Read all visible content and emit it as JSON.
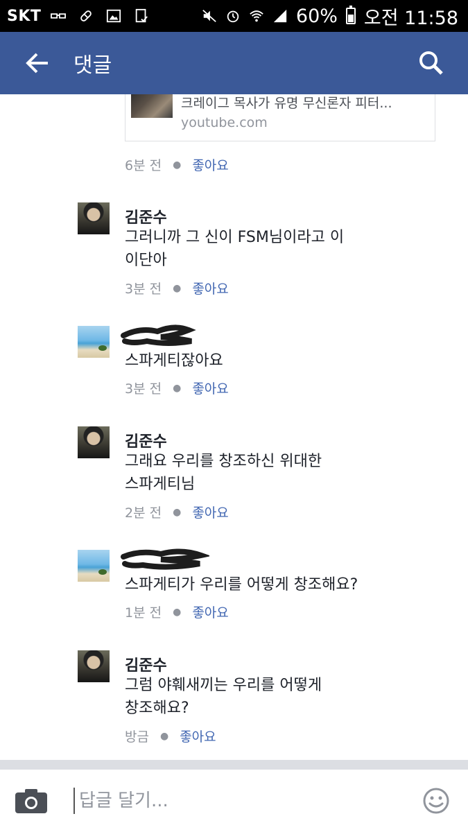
{
  "status_bar": {
    "carrier": "SKT",
    "battery": "60%",
    "time": "오전 11:58"
  },
  "header": {
    "title": "댓글",
    "back_icon": "arrow-left-icon",
    "search_icon": "search-icon",
    "color": "#3b5998"
  },
  "link_card": {
    "title": "크레이그 목사가 유명 무신론자 피터...",
    "domain": "youtube.com",
    "time": "6분 전",
    "like_label": "좋아요"
  },
  "comments": [
    {
      "name": "김준수",
      "text": "그러니까 그 신이 FSM님이라고 이\n이단아",
      "time": "3분 전",
      "like_label": "좋아요",
      "avatar": "kim"
    },
    {
      "name": "",
      "text": "스파게티잖아요",
      "time": "3분 전",
      "like_label": "좋아요",
      "avatar": "beach"
    },
    {
      "name": "김준수",
      "text": "그래요 우리를 창조하신 위대한\n스파게티님",
      "time": "2분 전",
      "like_label": "좋아요",
      "avatar": "kim"
    },
    {
      "name": "",
      "text": "스파게티가 우리를 어떻게 창조해요?",
      "time": "1분 전",
      "like_label": "좋아요",
      "avatar": "beach"
    },
    {
      "name": "김준수",
      "text": "그럼 야훼새끼는 우리를 어떻게\n창조해요?",
      "time": "방금",
      "like_label": "좋아요",
      "avatar": "kim"
    }
  ],
  "reply_bar": {
    "placeholder": "답글 달기...",
    "camera_icon": "camera-icon",
    "emoji_icon": "smiley-icon"
  },
  "colors": {
    "accent": "#3b5998",
    "like": "#4267b2",
    "meta": "#90949c",
    "text": "#1d2129"
  }
}
